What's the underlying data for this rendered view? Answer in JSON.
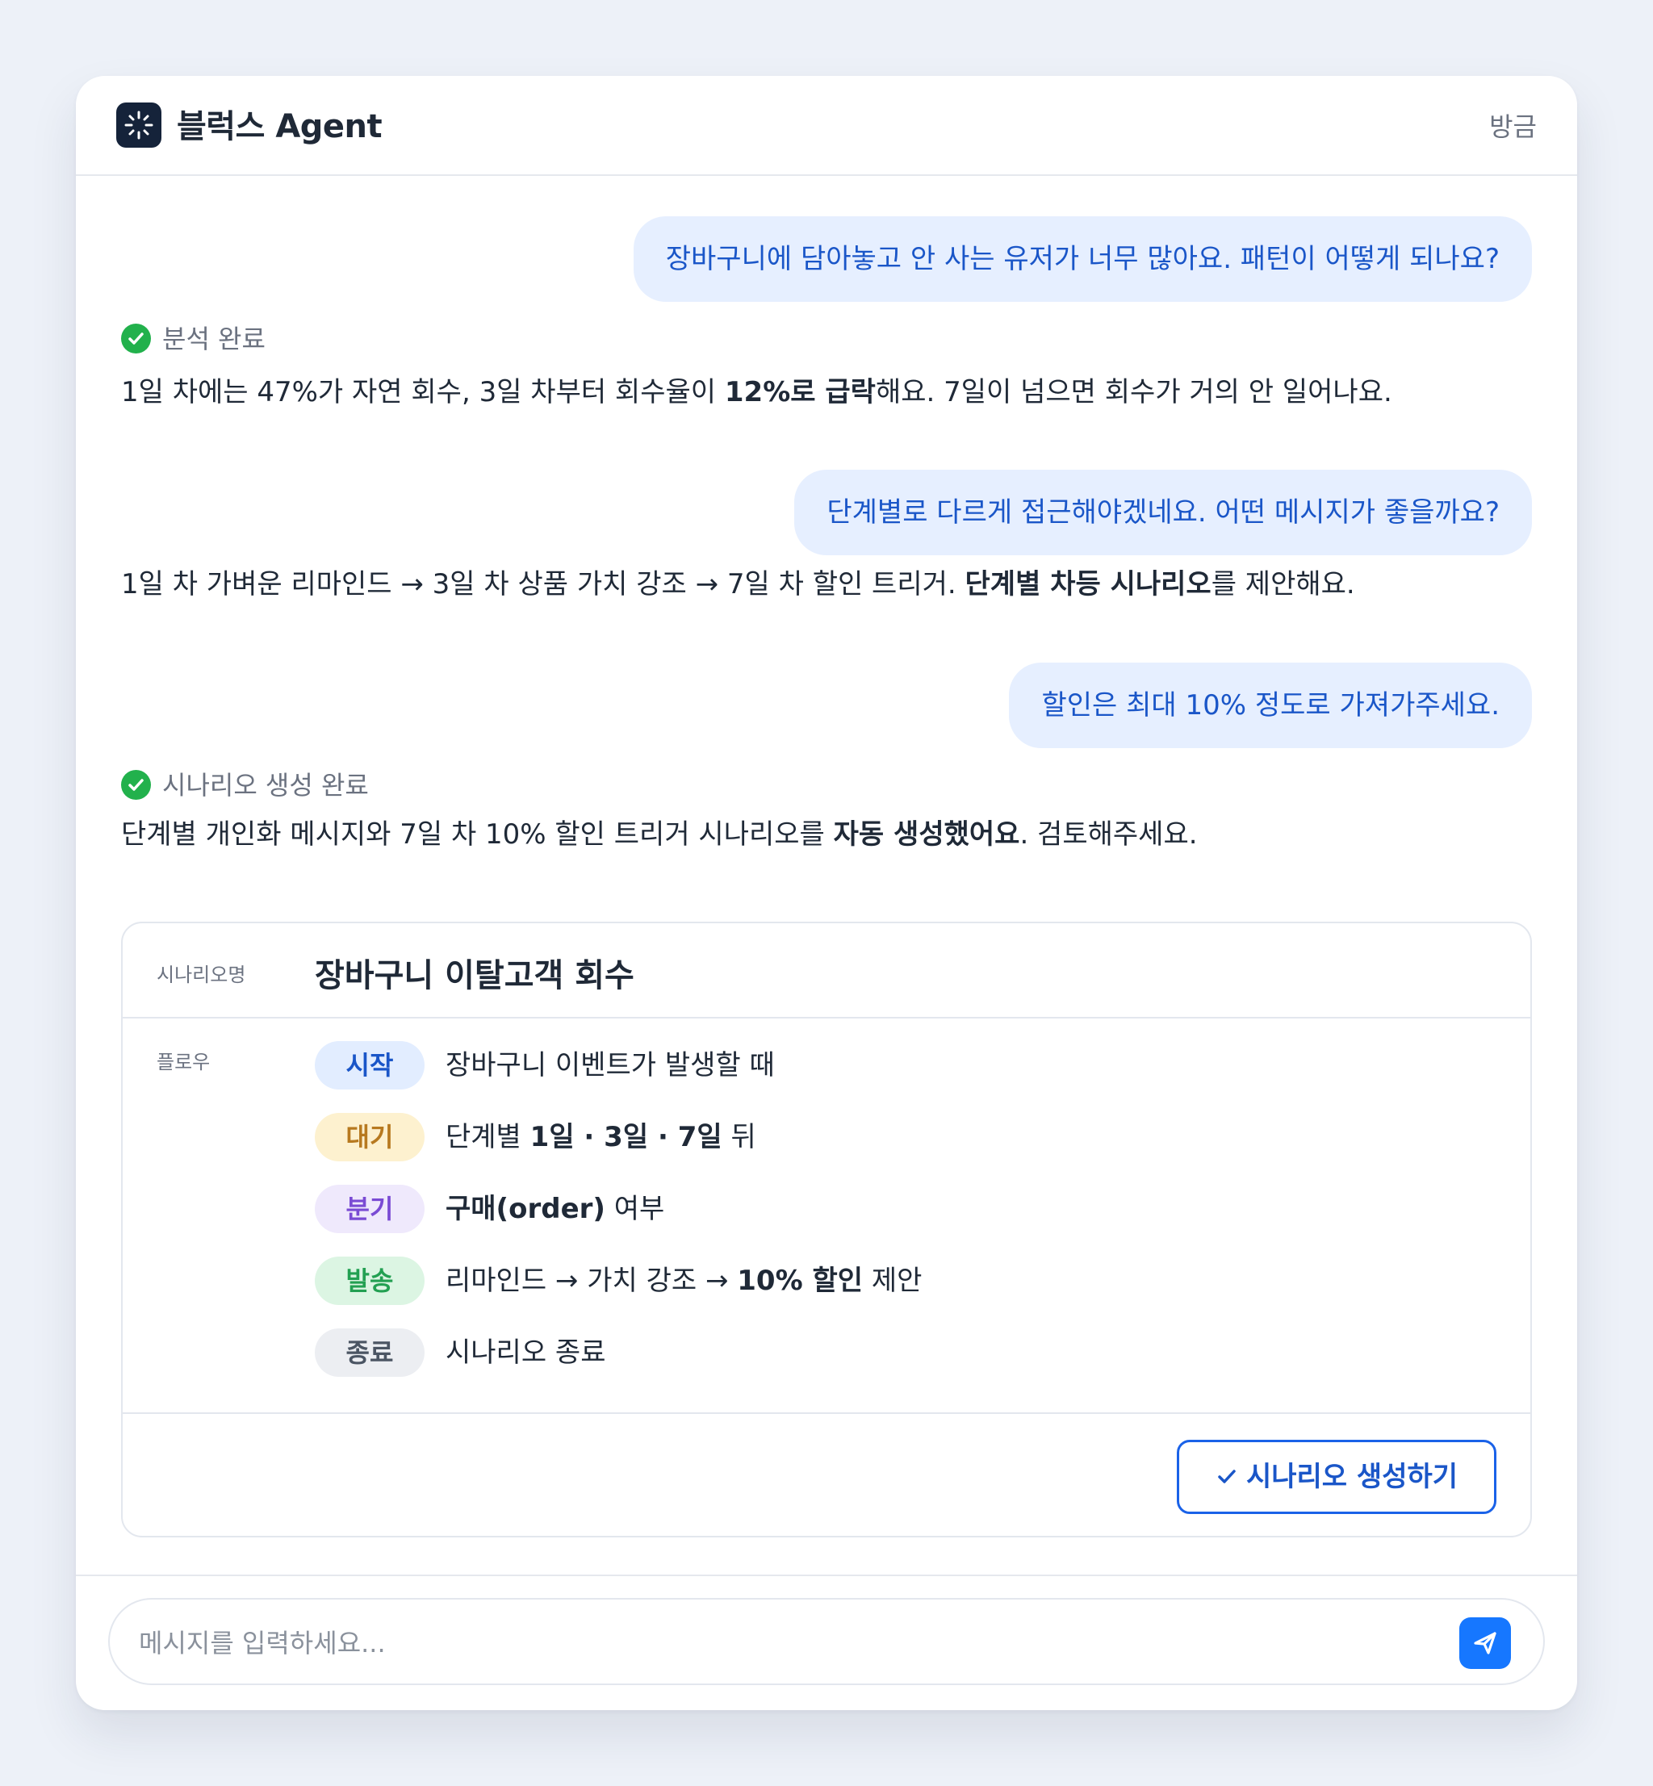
{
  "app": {
    "title": "블럭스 Agent",
    "time": "방금"
  },
  "messages": {
    "user1": "장바구니에 담아놓고 안 사는 유저가 너무 많아요. 패턴이 어떻게 되나요?",
    "status1": "분석 완료",
    "answer1": {
      "pre": "1일 차에는 47%가 자연 회수, 3일 차부터 회수율이 ",
      "bold": "12%로 급락",
      "post": "해요. 7일이 넘으면 회수가 거의 안 일어나요."
    },
    "user2": "단계별로 다르게 접근해야겠네요. 어떤 메시지가 좋을까요?",
    "answer2": {
      "pre": "1일 차 가벼운 리마인드 → 3일 차 상품 가치 강조 → 7일 차 할인 트리거. ",
      "bold": "단계별 차등 시나리오",
      "post": "를 제안해요."
    },
    "user3": "할인은 최대 10% 정도로 가져가주세요.",
    "status2": "시나리오 생성 완료",
    "answer3": {
      "pre": "단계별 개인화 메시지와 7일 차 10% 할인 트리거 시나리오를 ",
      "bold": "자동 생성했어요",
      "post": ". 검토해주세요."
    }
  },
  "scenario_card": {
    "name_label": "시나리오명",
    "name": "장바구니 이탈고객 회수",
    "flow_label": "플로우",
    "steps": [
      {
        "tag": "시작",
        "text_pre": "장바구니 이벤트가 발생할 때",
        "text_bold": "",
        "text_post": ""
      },
      {
        "tag": "대기",
        "text_pre": "단계별 ",
        "text_bold": "1일 · 3일 · 7일",
        "text_post": " 뒤"
      },
      {
        "tag": "분기",
        "text_pre": "",
        "text_bold": "구매(order)",
        "text_post": " 여부"
      },
      {
        "tag": "발송",
        "text_pre": "리마인드 → 가치 강조 → ",
        "text_bold": "10% 할인",
        "text_post": " 제안"
      },
      {
        "tag": "종료",
        "text_pre": "시나리오 종료",
        "text_bold": "",
        "text_post": ""
      }
    ],
    "create_button": "시나리오 생성하기"
  },
  "composer": {
    "placeholder": "메시지를 입력하세요..."
  },
  "colors": {
    "accent": "#1677ff",
    "user_bubble_bg": "#e6efff",
    "user_bubble_text": "#1a56c8",
    "success": "#22b14c"
  }
}
